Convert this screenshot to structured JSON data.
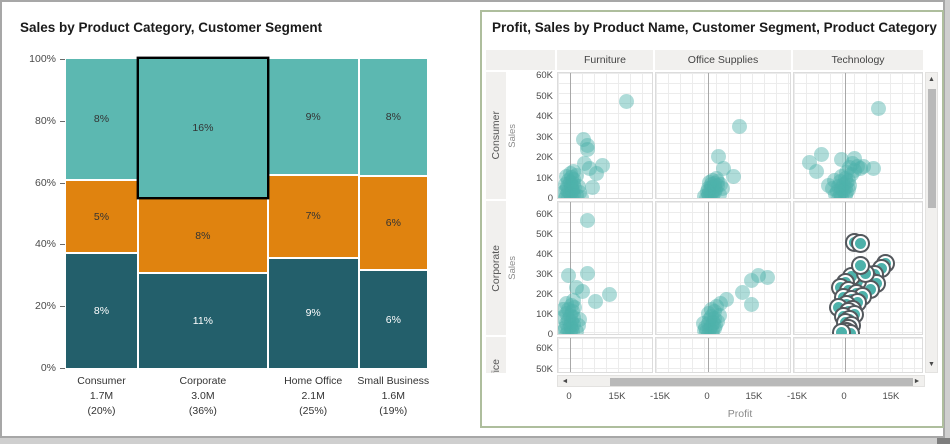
{
  "colors": {
    "mosaic_light_teal": "#5CB8B1",
    "mosaic_orange": "#E0830F",
    "mosaic_dark_teal": "#235F6B",
    "scatter_point": "#4DB1AA",
    "selected_ring": "#53575C",
    "panel_border": "#AEBE9D"
  },
  "icons": {
    "scroll_left": "◄",
    "scroll_right": "►",
    "scroll_up": "▲",
    "scroll_down": "▼"
  },
  "left_chart": {
    "title": "Sales by Product Category, Customer Segment",
    "y_axis_ticks": [
      "100%",
      "80%",
      "60%",
      "40%",
      "20%",
      "0%"
    ]
  },
  "right_chart": {
    "title": "Profit, Sales by Product Name, Customer Segment, Product Category",
    "column_headers": [
      "Furniture",
      "Office Supplies",
      "Technology"
    ],
    "row_labels": [
      "Consumer",
      "Corporate",
      "fice"
    ],
    "sales_axis_title": "Sales",
    "profit_axis_title": "Profit",
    "sales_ticks": [
      "60K",
      "50K",
      "40K",
      "30K",
      "20K",
      "10K",
      "0"
    ],
    "row3_ticks": [
      "60K",
      "50K"
    ],
    "profit_ticks": {
      "furniture": [
        "0",
        "15K"
      ],
      "office_supplies": [
        "-15K",
        "0",
        "15K"
      ],
      "technology": [
        "-15K",
        "0",
        "15K"
      ]
    }
  },
  "chart_data": [
    {
      "type": "mosaic",
      "title": "Sales by Product Category, Customer Segment",
      "y_axis": {
        "ticks_pct": [
          100,
          80,
          60,
          40,
          20,
          0
        ]
      },
      "selected": {
        "column": "Corporate",
        "segment": 0
      },
      "columns": [
        {
          "name": "Consumer",
          "total_label": "1.7M",
          "share_label": "(20%)",
          "width_pct": 20,
          "segments": [
            {
              "label": "8%",
              "series": "light",
              "height_pct": 39.5
            },
            {
              "label": "5%",
              "series": "orange",
              "height_pct": 23.6
            },
            {
              "label": "8%",
              "series": "dark",
              "height_pct": 36.9
            }
          ]
        },
        {
          "name": "Corporate",
          "total_label": "3.0M",
          "share_label": "(36%)",
          "width_pct": 36,
          "segments": [
            {
              "label": "16%",
              "series": "light",
              "height_pct": 45.3
            },
            {
              "label": "8%",
              "series": "orange",
              "height_pct": 24.3
            },
            {
              "label": "11%",
              "series": "dark",
              "height_pct": 30.4
            }
          ]
        },
        {
          "name": "Home Office",
          "total_label": "2.1M",
          "share_label": "(25%)",
          "width_pct": 25,
          "segments": [
            {
              "label": "9%",
              "series": "light",
              "height_pct": 37.9
            },
            {
              "label": "7%",
              "series": "orange",
              "height_pct": 26.8
            },
            {
              "label": "9%",
              "series": "dark",
              "height_pct": 35.3
            }
          ]
        },
        {
          "name": "Small Business",
          "total_label": "1.6M",
          "share_label": "(19%)",
          "width_pct": 19,
          "segments": [
            {
              "label": "8%",
              "series": "light",
              "height_pct": 38.2
            },
            {
              "label": "6%",
              "series": "orange",
              "height_pct": 30.4
            },
            {
              "label": "6%",
              "series": "dark",
              "height_pct": 31.4
            }
          ]
        }
      ]
    },
    {
      "type": "scatter-matrix",
      "title": "Profit, Sales by Product Name, Customer Segment, Product Category",
      "xlabel": "Profit",
      "ylabel": "Sales",
      "columns": [
        "Furniture",
        "Office Supplies",
        "Technology"
      ],
      "rows": [
        "Consumer",
        "Corporate",
        "Home Office (partial)"
      ],
      "x_tick_values_k": [
        -15,
        0,
        15
      ],
      "y_tick_values_k": [
        60,
        50,
        40,
        30,
        20,
        10,
        0
      ],
      "units": "K",
      "selected_panel": "corporate_technology",
      "panels": {
        "consumer_furniture": [
          [
            -1.5,
            0.5
          ],
          [
            -0.5,
            1
          ],
          [
            0.6,
            0.8
          ],
          [
            -1,
            1.8
          ],
          [
            0,
            2.5
          ],
          [
            1,
            2
          ],
          [
            -2,
            3
          ],
          [
            -0.5,
            3.5
          ],
          [
            0.8,
            4
          ],
          [
            -1.2,
            4.6
          ],
          [
            0.3,
            5
          ],
          [
            1.5,
            5.6
          ],
          [
            -0.8,
            6
          ],
          [
            0.5,
            6.6
          ],
          [
            -1.5,
            7
          ],
          [
            1,
            7.6
          ],
          [
            0,
            8.2
          ],
          [
            -0.5,
            9
          ],
          [
            1.2,
            9.6
          ],
          [
            0.5,
            10.5
          ],
          [
            -1,
            11
          ],
          [
            2,
            11.6
          ],
          [
            0,
            12.5
          ],
          [
            1,
            13.6
          ],
          [
            2.5,
            6
          ],
          [
            3,
            3
          ],
          [
            2,
            1.5
          ],
          [
            3.6,
            1
          ],
          [
            6.9,
            5.4
          ],
          [
            8.4,
            12.7
          ],
          [
            10.2,
            16.5
          ],
          [
            6,
            15
          ],
          [
            4.1,
            29
          ],
          [
            5.3,
            26.3
          ],
          [
            5.6,
            24
          ],
          [
            4.5,
            17.5
          ],
          [
            17.5,
            47.8
          ]
        ],
        "consumer_office_supplies": [
          [
            -0.5,
            0.5
          ],
          [
            0.5,
            1
          ],
          [
            1.5,
            1.5
          ],
          [
            0,
            2
          ],
          [
            1,
            2.6
          ],
          [
            2,
            3
          ],
          [
            0.5,
            3.6
          ],
          [
            1.6,
            4
          ],
          [
            2.5,
            4.6
          ],
          [
            0,
            5
          ],
          [
            1,
            5.6
          ],
          [
            2,
            6
          ],
          [
            3,
            6.6
          ],
          [
            1,
            7
          ],
          [
            2.2,
            7.6
          ],
          [
            0.5,
            8
          ],
          [
            3,
            8.6
          ],
          [
            1.5,
            9
          ],
          [
            2.6,
            9.8
          ],
          [
            4,
            7
          ],
          [
            4.5,
            5
          ],
          [
            3.5,
            2
          ],
          [
            -1,
            1.2
          ],
          [
            -0.3,
            3.8
          ],
          [
            5,
            14.8
          ],
          [
            8,
            11.2
          ],
          [
            3.2,
            21
          ],
          [
            10,
            35.5
          ]
        ],
        "consumer_technology": [
          [
            -2,
            0.5
          ],
          [
            -1,
            1
          ],
          [
            0,
            1.6
          ],
          [
            -3,
            2
          ],
          [
            -1.5,
            2.6
          ],
          [
            0.5,
            3
          ],
          [
            -2.5,
            3.6
          ],
          [
            -0.5,
            4
          ],
          [
            1,
            4.6
          ],
          [
            -1,
            5
          ],
          [
            0,
            5.6
          ],
          [
            -2,
            6
          ],
          [
            1.5,
            6.6
          ],
          [
            -0.5,
            7
          ],
          [
            0.5,
            8
          ],
          [
            -1.6,
            8.6
          ],
          [
            1,
            9
          ],
          [
            0,
            10
          ],
          [
            -1,
            11
          ],
          [
            2,
            12
          ],
          [
            0.5,
            13
          ],
          [
            3,
            14
          ],
          [
            1.5,
            15.5
          ],
          [
            4,
            16
          ],
          [
            2.5,
            17.5
          ],
          [
            5,
            15
          ],
          [
            -4,
            5
          ],
          [
            -3.5,
            9
          ],
          [
            -5.2,
            6.7
          ],
          [
            -11.3,
            18
          ],
          [
            -9,
            13.3
          ],
          [
            -7.4,
            21.9
          ],
          [
            -1,
            19.5
          ],
          [
            5.8,
            15.7
          ],
          [
            9,
            14.8
          ],
          [
            3,
            20
          ],
          [
            10.6,
            44.3
          ]
        ],
        "corporate_furniture": [
          [
            -1,
            0.5
          ],
          [
            0,
            1
          ],
          [
            -2,
            1.6
          ],
          [
            0.8,
            2
          ],
          [
            -0.5,
            2.6
          ],
          [
            0.5,
            3.2
          ],
          [
            -1.5,
            4
          ],
          [
            0,
            4.8
          ],
          [
            1,
            5.5
          ],
          [
            -1,
            6
          ],
          [
            0.5,
            7
          ],
          [
            -0.5,
            8
          ],
          [
            1.2,
            9
          ],
          [
            0,
            10
          ],
          [
            -1.2,
            11
          ],
          [
            0.8,
            12
          ],
          [
            -0.5,
            13
          ],
          [
            1.5,
            14
          ],
          [
            0.3,
            15
          ],
          [
            -1,
            16
          ],
          [
            1,
            17.5
          ],
          [
            2,
            2
          ],
          [
            2.5,
            5
          ],
          [
            3,
            8
          ],
          [
            -2.5,
            9
          ],
          [
            -2,
            13
          ],
          [
            4,
            22
          ],
          [
            2,
            24
          ],
          [
            -0.6,
            30
          ],
          [
            5.4,
            31
          ],
          [
            12.2,
            20.5
          ],
          [
            8,
            16.7
          ],
          [
            5.6,
            57.5
          ]
        ],
        "corporate_office_supplies": [
          [
            0,
            0.5
          ],
          [
            1,
            1
          ],
          [
            -0.5,
            1.6
          ],
          [
            1.5,
            2
          ],
          [
            0.5,
            2.8
          ],
          [
            2,
            3.5
          ],
          [
            -0.8,
            4
          ],
          [
            1,
            4.6
          ],
          [
            2.5,
            5
          ],
          [
            0,
            5.6
          ],
          [
            1.8,
            6.5
          ],
          [
            3,
            7
          ],
          [
            0.5,
            7.6
          ],
          [
            2.2,
            8.5
          ],
          [
            1,
            9.5
          ],
          [
            3.5,
            10
          ],
          [
            0,
            11
          ],
          [
            2,
            12
          ],
          [
            1,
            13
          ],
          [
            2.8,
            14.5
          ],
          [
            4,
            16
          ],
          [
            -1,
            2.2
          ],
          [
            -1.5,
            6
          ],
          [
            6,
            18
          ],
          [
            11,
            21.5
          ],
          [
            13.9,
            15.5
          ],
          [
            13.9,
            27.5
          ],
          [
            16.1,
            30
          ],
          [
            19,
            29
          ]
        ],
        "corporate_technology": [
          [
            3,
            46.5
          ],
          [
            4.8,
            46
          ],
          [
            13,
            36
          ],
          [
            11.5,
            33.5
          ],
          [
            9.5,
            30.5
          ],
          [
            7.5,
            28
          ],
          [
            10,
            26
          ],
          [
            6,
            25
          ],
          [
            8,
            23
          ],
          [
            4,
            27
          ],
          [
            2,
            29.5
          ],
          [
            0,
            26.5
          ],
          [
            -1.5,
            24
          ],
          [
            1,
            22.5
          ],
          [
            3.5,
            21
          ],
          [
            5.5,
            19.5
          ],
          [
            -0.5,
            19
          ],
          [
            2,
            18
          ],
          [
            4,
            16.5
          ],
          [
            0.5,
            15.5
          ],
          [
            -2,
            14
          ],
          [
            2.5,
            13
          ],
          [
            1,
            12
          ],
          [
            3,
            10.5
          ],
          [
            -0.5,
            9.5
          ],
          [
            1.5,
            8
          ],
          [
            0,
            6.5
          ],
          [
            2,
            5
          ],
          [
            1,
            3.5
          ],
          [
            0.5,
            2
          ],
          [
            1.8,
            0.8
          ],
          [
            -1,
            1.5
          ],
          [
            6.5,
            31
          ],
          [
            5,
            35
          ]
        ],
        "home_office_furniture": [],
        "home_office_office_supplies": [],
        "home_office_technology": []
      }
    }
  ]
}
